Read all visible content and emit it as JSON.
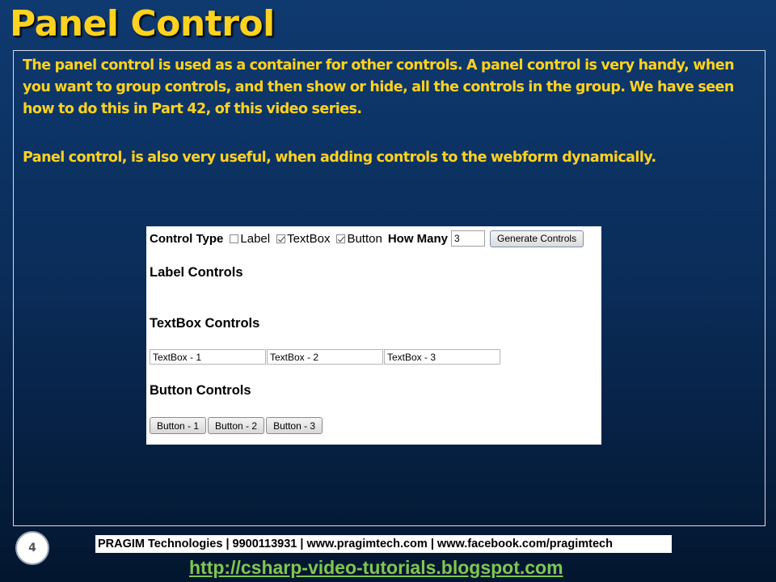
{
  "slide": {
    "title": "Panel Control",
    "paragraph_1": "The panel control is used as a container for other controls. A panel control is very handy, when you want to group controls, and then show or hide, all the controls in the group. We have seen how to do this in Part 42, of this video series.",
    "paragraph_2": "Panel control, is also very useful, when adding controls to the webform dynamically.",
    "page_number": "4",
    "footer_info": "PRAGIM Technologies | 9900113931 | www.pragimtech.com | www.facebook.com/pragimtech",
    "blog_link": "http://csharp-video-tutorials.blogspot.com"
  },
  "demo": {
    "control_type_label": "Control Type",
    "checkboxes": [
      {
        "label": "Label",
        "checked": false
      },
      {
        "label": "TextBox",
        "checked": true
      },
      {
        "label": "Button",
        "checked": true
      }
    ],
    "how_many_label": "How Many",
    "how_many_value": "3",
    "generate_button": "Generate Controls",
    "label_section_title": "Label Controls",
    "textbox_section_title": "TextBox Controls",
    "textboxes": [
      "TextBox - 1",
      "TextBox - 2",
      "TextBox - 3"
    ],
    "button_section_title": "Button Controls",
    "buttons": [
      "Button - 1",
      "Button - 2",
      "Button - 3"
    ]
  },
  "colors": {
    "title_yellow": "#ffd21f",
    "background_blue": "#0a2c58",
    "link_green": "#7ec850"
  }
}
